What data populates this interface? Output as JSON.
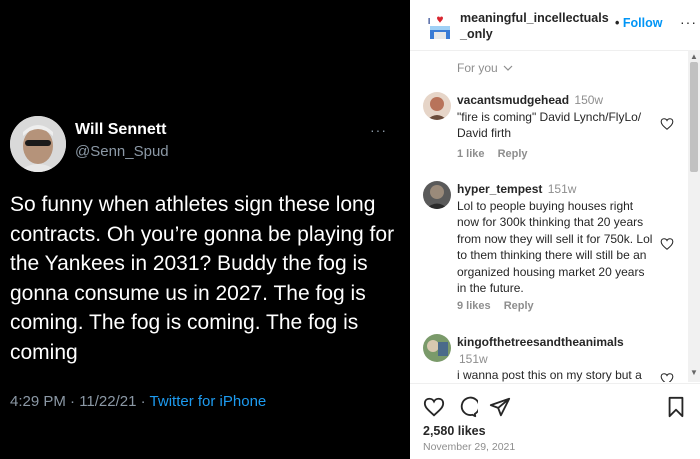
{
  "tweet": {
    "author_name": "Will Sennett",
    "author_handle": "@Senn_Spud",
    "more": "···",
    "text": "So funny when athletes sign these long contracts. Oh you’re gonna be playing for the Yankees in 2031? Buddy the fog is gonna consume us in 2027. The fog is coming. The fog is coming. The fog is coming",
    "time": "4:29 PM · 11/22/21 · ",
    "source": "Twitter for iPhone"
  },
  "instagram": {
    "username": "meaningful_incellectuals_only",
    "follow_dot": "•",
    "follow_label": "Follow",
    "more": "···",
    "for_you_label": "For you",
    "comments": [
      {
        "user": "vacantsmudgehead",
        "time": "150w",
        "text": "\"fire is coming\" David Lynch/FlyLo/ David firth",
        "likes": "1 like",
        "reply": "Reply"
      },
      {
        "user": "hyper_tempest",
        "time": "151w",
        "text": "Lol to people buying houses right now for 300k thinking that 20 years from now they will sell it for 750k. Lol to them thinking there will still be an organized housing market 20 years in the future.",
        "likes": "9 likes",
        "reply": "Reply"
      },
      {
        "user": "kingofthetreesandtheanimals",
        "time": "151w",
        "text": "i wanna post this on my story but a lot of my friends suffer from severe",
        "likes": "",
        "reply": ""
      }
    ],
    "likes_count": "2,580 likes",
    "date": "November 29, 2021"
  },
  "colors": {
    "tweet_bg": "#000000",
    "tweet_secondary": "#8b98a5",
    "tweet_link": "#1d9bf0",
    "ig_follow": "#0095f6",
    "ig_text": "#262626",
    "ig_muted": "#8e8e8e"
  },
  "icons": [
    "chevron-down-icon",
    "heart-icon",
    "comment-icon",
    "share-icon",
    "bookmark-icon",
    "more-icon"
  ]
}
